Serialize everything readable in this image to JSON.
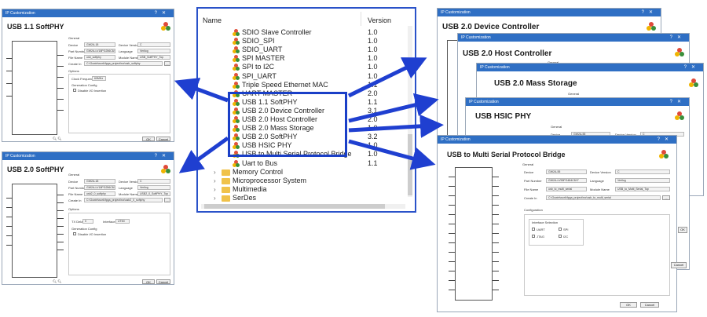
{
  "list": {
    "header": {
      "name": "Name",
      "version": "Version"
    },
    "items": [
      {
        "name": "SDIO Slave Controller",
        "version": "1.0"
      },
      {
        "name": "SDIO_SPI",
        "version": "1.0"
      },
      {
        "name": "SDIO_UART",
        "version": "1.0"
      },
      {
        "name": "SPI MASTER",
        "version": "1.0"
      },
      {
        "name": "SPI to I2C",
        "version": "1.0"
      },
      {
        "name": "SPI_UART",
        "version": "1.0"
      },
      {
        "name": "Triple Speed Ethernet MAC",
        "version": "1.1"
      },
      {
        "name": "UART MASTER",
        "version": "2.0"
      },
      {
        "name": "USB 1.1 SoftPHY",
        "version": "1.1"
      },
      {
        "name": "USB 2.0 Device Controller",
        "version": "3.1"
      },
      {
        "name": "USB 2.0 Host Controller",
        "version": "2.0"
      },
      {
        "name": "USB 2.0 Mass Storage",
        "version": "1.0"
      },
      {
        "name": "USB 2.0 SoftPHY",
        "version": "3.2"
      },
      {
        "name": "USB HSIC PHY",
        "version": "1.0"
      },
      {
        "name": "USB to Multi Serial Protocol Bridge",
        "version": "1.0"
      },
      {
        "name": "Uart to Bus",
        "version": "1.1"
      }
    ],
    "folders": [
      "Memory Control",
      "Microprocessor System",
      "Multimedia",
      "SerDes"
    ]
  },
  "dialogs": {
    "title": "IP Customization",
    "softphy11": {
      "heading": "USB 1.1 SoftPHY",
      "general": "General",
      "device": "Device",
      "device_val": "GW2A-18",
      "device_version": "Device Version",
      "device_version_val": "C",
      "part_number": "Part Number",
      "part_number_val": "GW2A-LV18PG256C8/I7",
      "language": "Language",
      "language_val": "Verilog",
      "file_name": "File Name",
      "file_name_val": "usb_softphy",
      "module_name": "Module Name",
      "module_name_val": "USB_SoftPHY_Top",
      "create_in": "Create In",
      "create_in_val": "C:\\Gowin\\work\\fpga_project\\src\\usb_softphy",
      "options": "Options",
      "clock_freq": "Clock Frequency",
      "clock_freq_val": "60MHz",
      "gen_config": "Generation Config",
      "disable_io": "Disable I/O Insertion",
      "ok": "OK",
      "cancel": "Cancel"
    },
    "softphy20": {
      "heading": "USB 2.0 SoftPHY",
      "general": "General",
      "device": "Device",
      "device_val": "GW2A-18",
      "device_version": "Device Version",
      "device_version_val": "C",
      "part_number": "Part Number",
      "part_number_val": "GW2A-LV18PG256C8/I7",
      "language": "Language",
      "language_val": "Verilog",
      "file_name": "File Name",
      "file_name_val": "usb2_0_softphy",
      "module_name": "Module Name",
      "module_name_val": "USB2_0_SoftPHY_Top",
      "create_in": "Create In",
      "create_in_val": "C:\\Gowin\\work\\fpga_project\\src\\usb2_0_softphy",
      "options": "Options",
      "tx_delay": "TX Delay",
      "tx_delay_val": "0",
      "interface": "Interface",
      "interface_val": "UTMI",
      "gen_config": "Generation Config",
      "disable_io": "Disable I/O Insertion",
      "ok": "OK",
      "cancel": "Cancel"
    },
    "device_ctrl": {
      "heading": "USB 2.0 Device Controller"
    },
    "host_ctrl": {
      "heading": "USB 2.0 Host Controller",
      "general": "General"
    },
    "mass_storage": {
      "heading": "USB 2.0 Mass Storage",
      "general": "General"
    },
    "hsic": {
      "heading": "USB HSIC PHY",
      "general": "General",
      "device": "Device",
      "device_val": "GW2A-55",
      "device_version": "Device Version",
      "device_version_val": "C"
    },
    "bridge": {
      "heading": "USB to Multi Serial Protocol Bridge",
      "general": "General",
      "device": "Device",
      "device_val": "GW2A-55",
      "device_version": "Device Version",
      "device_version_val": "C",
      "part_number": "Part Number",
      "part_number_val": "GW2A-LV55PG484C8/I7",
      "language": "Language",
      "language_val": "Verilog",
      "file_name": "File Name",
      "file_name_val": "usb_to_multi_serial",
      "module_name": "Module Name",
      "module_name_val": "USB_to_Multi_Serial_Top",
      "create_in": "Create In",
      "create_in_val": "C:\\Gowin\\work\\fpga_project\\src\\usb_to_multi_serial",
      "configuration": "Configuration",
      "interface_selection": "Interface Selection",
      "uart": "UART",
      "spi": "SPI",
      "jtag": "JTAG",
      "i2c": "I2C",
      "ok": "OK",
      "cancel": "Cancel"
    }
  },
  "colors": {
    "titlebar": "#2f6fc4",
    "highlight": "#1a3fc7",
    "arrow": "#1f3fd0"
  }
}
